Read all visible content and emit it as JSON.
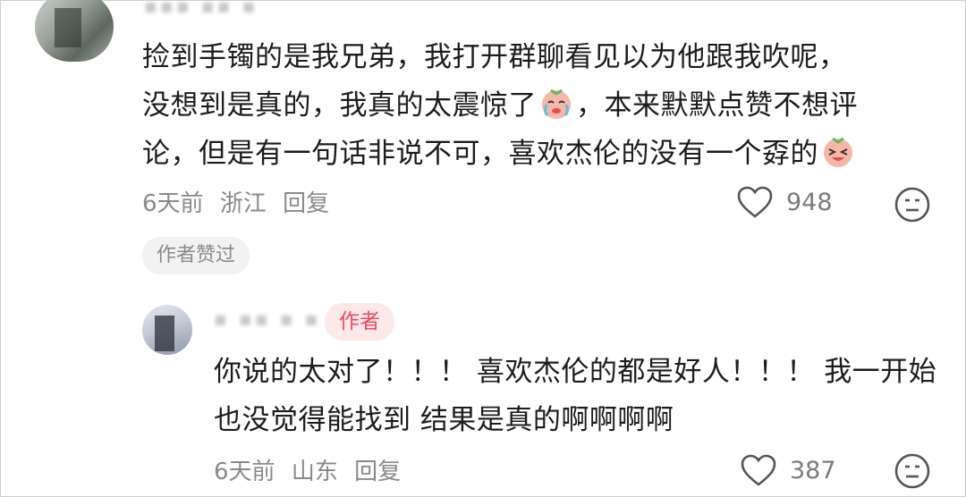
{
  "comment": {
    "lines": [
      "捡到手镯的是我兄弟，我打开群聊看见以为他跟我吹呢，",
      "没想到是真的，我真的太震惊了",
      "，本来默默点赞不想评",
      "论，但是有一句话非说不可，喜欢杰伦的没有一个孬的"
    ],
    "emoji_1": "crying-face-emoji",
    "emoji_2": "laughing-face-emoji",
    "time": "6天前",
    "location": "浙江",
    "reply_label": "回复",
    "like_count": "948",
    "author_liked_tag": "作者赞过"
  },
  "reply": {
    "author_tag": "作者",
    "lines": [
      "你说的太对了！！！ 喜欢杰伦的都是好人！！！ 我一开始",
      "也没觉得能找到 结果是真的啊啊啊啊"
    ],
    "time": "6天前",
    "location": "山东",
    "reply_label": "回复",
    "like_count": "387"
  },
  "colors": {
    "author_tag_text": "#f04a5c",
    "author_tag_bg": "#fde9ea",
    "meta_text": "#8a8a8a"
  }
}
